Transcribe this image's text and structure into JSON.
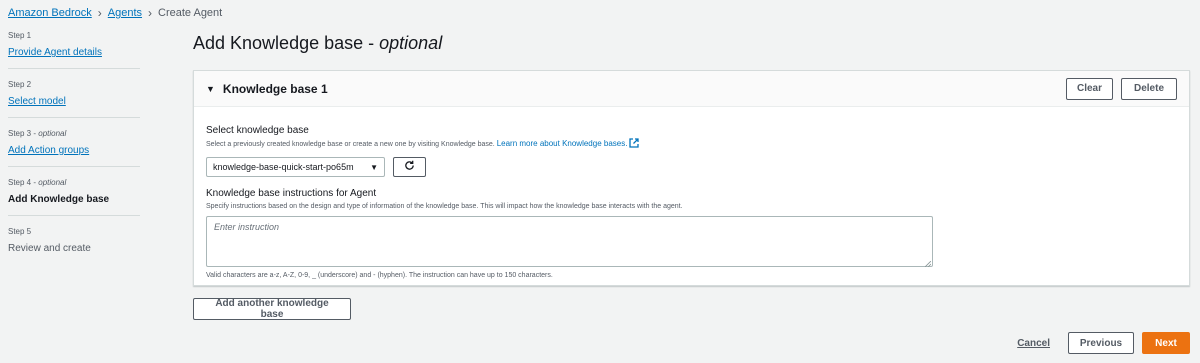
{
  "breadcrumb": {
    "items": [
      {
        "label": "Amazon Bedrock"
      },
      {
        "label": "Agents"
      }
    ],
    "current": "Create Agent"
  },
  "steps": [
    {
      "num": "Step 1",
      "optional": "",
      "title": "Provide Agent details",
      "state": "link"
    },
    {
      "num": "Step 2",
      "optional": "",
      "title": "Select model",
      "state": "link"
    },
    {
      "num": "Step 3 - ",
      "optional": "optional",
      "title": "Add Action groups",
      "state": "link"
    },
    {
      "num": "Step 4 - ",
      "optional": "optional",
      "title": "Add Knowledge base",
      "state": "active"
    },
    {
      "num": "Step 5",
      "optional": "",
      "title": "Review and create",
      "state": "plain"
    }
  ],
  "page": {
    "title": "Add Knowledge base - ",
    "title_optional": "optional"
  },
  "panel": {
    "title": "Knowledge base 1",
    "clear_label": "Clear",
    "delete_label": "Delete",
    "select_label": "Select knowledge base",
    "select_desc": "Select a previously created knowledge base or create a new one by visiting Knowledge base.",
    "select_link": "Learn more about Knowledge bases.",
    "select_value": "knowledge-base-quick-start-po65m",
    "instr_label": "Knowledge base instructions for Agent",
    "instr_desc": "Specify instructions based on the design and type of information of the knowledge base. This will impact how the knowledge base interacts with the agent.",
    "instr_placeholder": "Enter instruction",
    "instr_constraint": "Valid characters are a-z, A-Z, 0-9, _ (underscore) and - (hyphen). The instruction can have up to 150 characters."
  },
  "add_another_label": "Add another knowledge base",
  "footer": {
    "cancel_label": "Cancel",
    "previous_label": "Previous",
    "next_label": "Next"
  },
  "colors": {
    "link": "#0073bb",
    "primary": "#ec7211",
    "border": "#d5dbdb"
  }
}
